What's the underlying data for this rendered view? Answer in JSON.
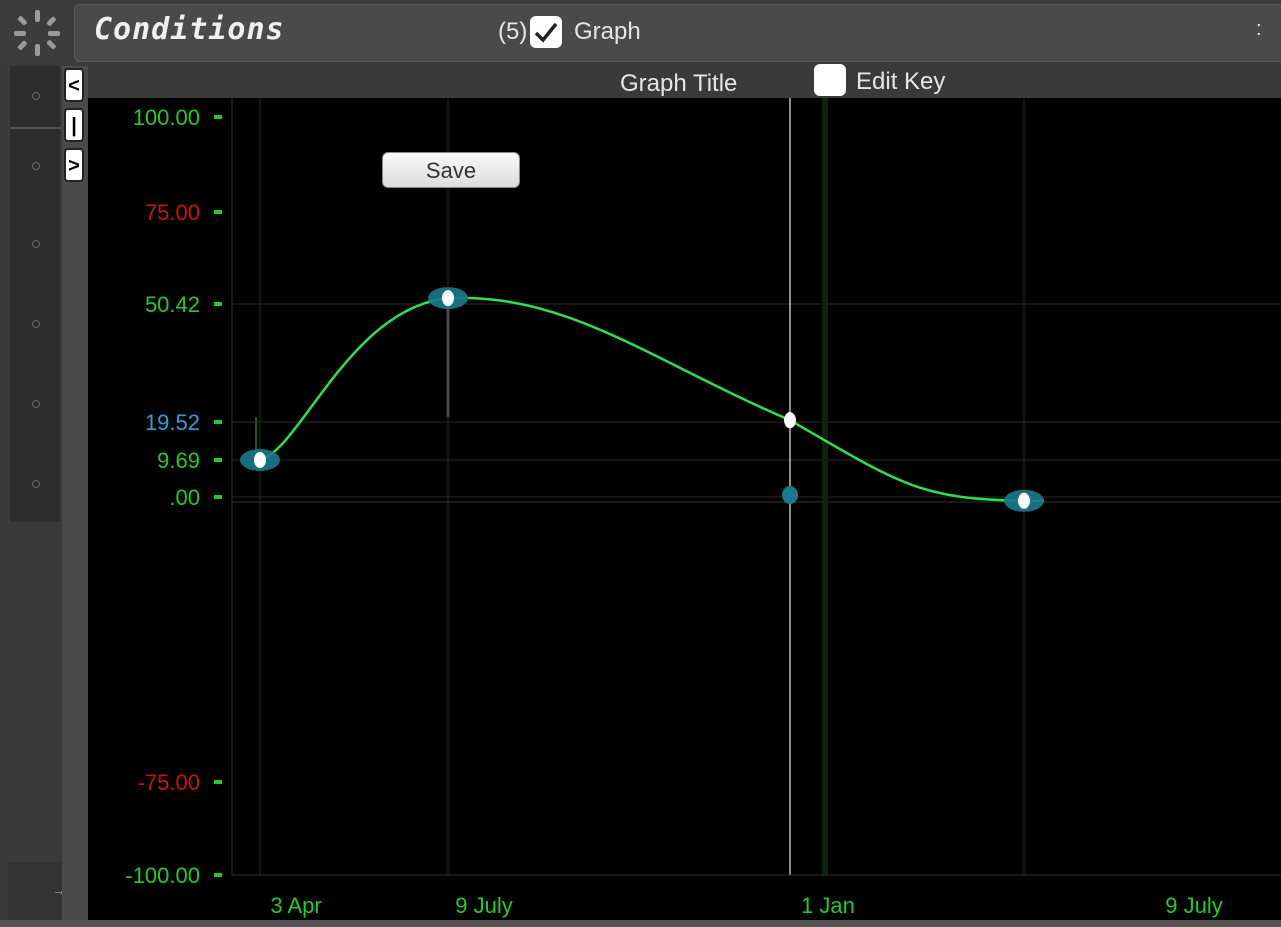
{
  "panel": {
    "title": "Conditions",
    "count": "(5)",
    "graph_toggle_label": "Graph",
    "graph_checked": true,
    "menu_icon": "colon-menu-icon",
    "menu_glyph": ":"
  },
  "toolbar": {
    "graph_title": "Graph Title",
    "edit_key_label": "Edit Key",
    "edit_key_checked": false,
    "save_label": "Save"
  },
  "nav": {
    "prev": "<",
    "mid": "|",
    "next": ">"
  },
  "colors": {
    "accent_green": "#2ee04a",
    "label_green": "#22cc22",
    "label_red": "#cc1111",
    "label_blue": "#2a9fe0",
    "point_fill": "#ffffff",
    "point_halo": "#1a7a8c"
  },
  "chart_data": {
    "type": "line",
    "y_ticks": [
      {
        "value": 100,
        "label": "100.00",
        "color": "#22cc22"
      },
      {
        "value": 75,
        "label": "75.00",
        "color": "#cc1111"
      },
      {
        "value": 50.42,
        "label": "50.42",
        "color": "#22cc22"
      },
      {
        "value": 19.52,
        "label": "19.52",
        "color": "#2a9fe0"
      },
      {
        "value": 9.69,
        "label": "9.69",
        "color": "#22cc22"
      },
      {
        "value": 0,
        "label": ".00",
        "color": "#22cc22"
      },
      {
        "value": -75,
        "label": "-75.00",
        "color": "#cc1111"
      },
      {
        "value": -100,
        "label": "-100.00",
        "color": "#22cc22"
      }
    ],
    "x_ticks": [
      "3 Apr",
      "9 July",
      "1 Jan",
      "9 July"
    ],
    "series": [
      {
        "points": [
          {
            "x": "3 Apr",
            "y": 9.69
          },
          {
            "x": "9 July",
            "y": 52
          },
          {
            "x": "1 Jan",
            "y": 20
          },
          {
            "x": "Jul",
            "y": -1
          }
        ]
      }
    ],
    "ylim": [
      -100,
      100
    ],
    "grid": true
  }
}
